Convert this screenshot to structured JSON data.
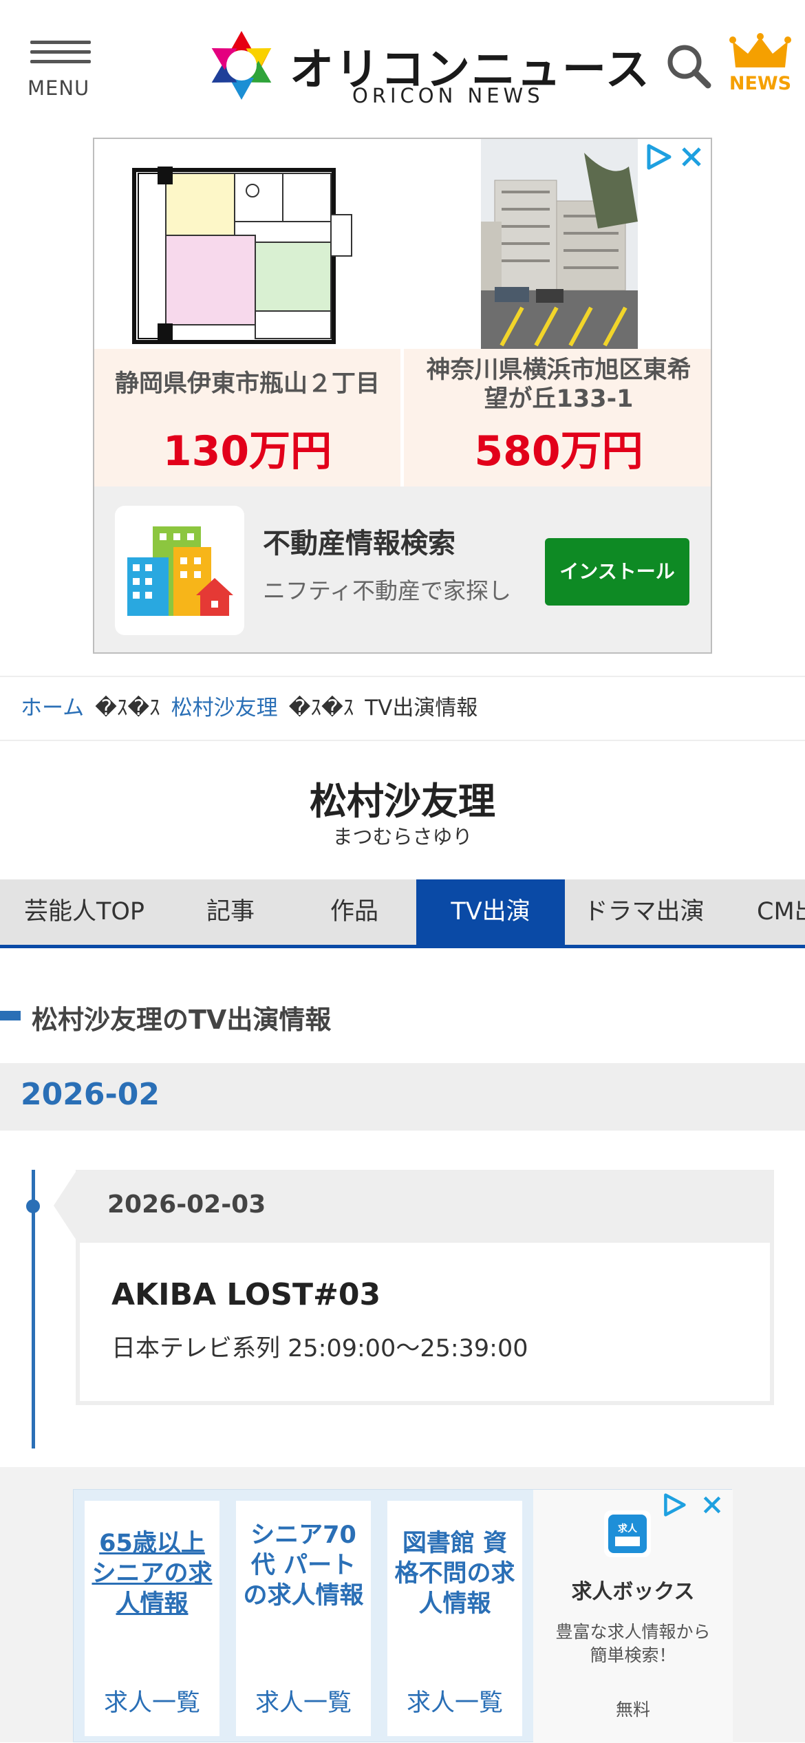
{
  "header": {
    "menu_label": "MENU",
    "logo_jp": "オリコンニュース",
    "logo_en": "ORICON NEWS",
    "news_label": "NEWS"
  },
  "ad_top": {
    "listings": [
      {
        "address": "静岡県伊東市瓶山２丁目",
        "price": "130万円"
      },
      {
        "address": "神奈川県横浜市旭区東希望が丘133-1",
        "price": "580万円"
      }
    ],
    "app_title": "不動産情報検索",
    "app_desc": "ニフティ不動産で家探し",
    "install_label": "インストール"
  },
  "breadcrumb": {
    "home": "ホーム",
    "sep": "�ｽ�ｽ",
    "artist": "松村沙友理",
    "current": "TV出演情報"
  },
  "artist": {
    "name": "松村沙友理",
    "kana": "まつむらさゆり"
  },
  "tabs": [
    {
      "label": "芸能人TOP"
    },
    {
      "label": "記事"
    },
    {
      "label": "作品"
    },
    {
      "label": "TV出演"
    },
    {
      "label": "ドラマ出演"
    },
    {
      "label": "CM出演"
    }
  ],
  "section": {
    "heading": "松村沙友理のTV出演情報",
    "month": "2026-02",
    "entries": [
      {
        "date": "2026-02-03",
        "title": "AKIBA LOST#03",
        "info": "日本テレビ系列 25:09:00〜25:39:00"
      }
    ]
  },
  "ad_bottom": {
    "jobs": [
      {
        "title": "65歳以上シニアの求人情報",
        "link": "求人一覧"
      },
      {
        "title": "シニア70代 パートの求人情報",
        "link": "求人一覧"
      },
      {
        "title": "図書館 資格不問の求人情報",
        "link": "求人一覧"
      }
    ],
    "brand_logo_text": "求人ボックス",
    "brand_name": "求人ボックス",
    "brand_desc": "豊富な求人情報から簡単検索！",
    "brand_free": "無料"
  },
  "colors": {
    "accent_blue": "#2a6fb6",
    "tab_active": "#0a4aa6",
    "price_red": "#e2001a",
    "install_green": "#0e8a24",
    "news_orange": "#f5a000"
  }
}
